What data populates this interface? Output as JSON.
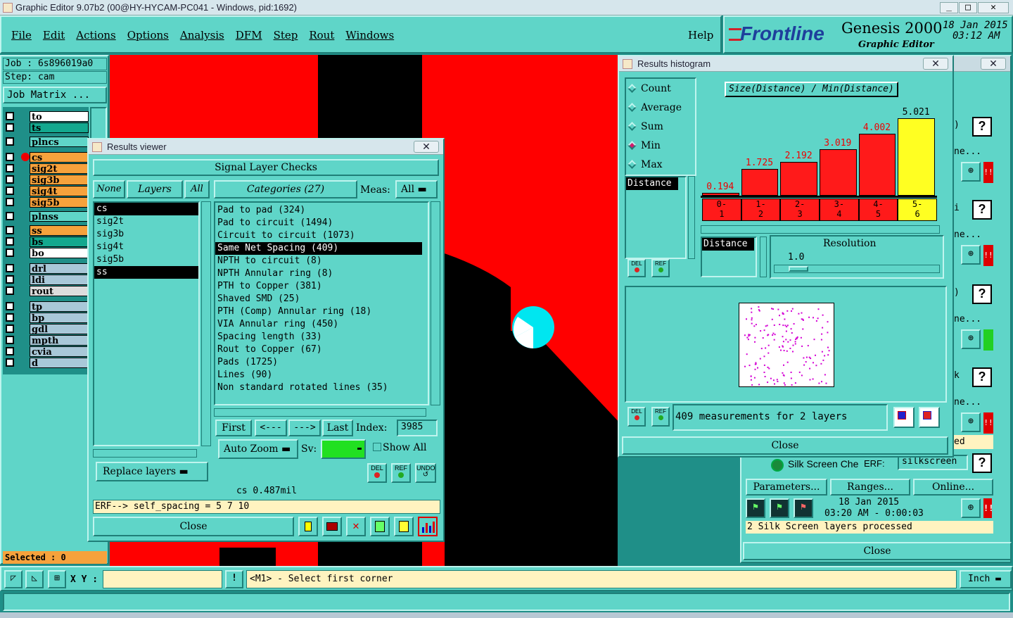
{
  "window": {
    "title": "Graphic Editor 9.07b2 (00@HY-HYCAM-PC041 - Windows, pid:1692)"
  },
  "menu": {
    "items": [
      "File",
      "Edit",
      "Actions",
      "Options",
      "Analysis",
      "DFM",
      "Step",
      "Rout",
      "Windows"
    ],
    "help": "Help"
  },
  "brand": {
    "logo": "Frontline",
    "product": "Genesis 2000",
    "subtitle": "Graphic Editor",
    "date": "18 Jan 2015",
    "time": "03:12 AM"
  },
  "job": {
    "job_label": "Job : 6s896019a0",
    "step_label": "Step: cam",
    "matrix_button": "Job Matrix ..."
  },
  "layers": [
    {
      "name": "to",
      "bg": "#ffffff"
    },
    {
      "name": "ts",
      "bg": "#13a88e"
    },
    {
      "name": "plncs",
      "bg": "#5fd5c8"
    },
    {
      "name": "cs",
      "bg": "#f6a23c"
    },
    {
      "name": "sig2t",
      "bg": "#f6a23c"
    },
    {
      "name": "sig3b",
      "bg": "#f6a23c"
    },
    {
      "name": "sig4t",
      "bg": "#f6a23c"
    },
    {
      "name": "sig5b",
      "bg": "#f6a23c"
    },
    {
      "name": "plnss",
      "bg": "#5fd5c8"
    },
    {
      "name": "ss",
      "bg": "#f6a23c"
    },
    {
      "name": "bs",
      "bg": "#13a88e"
    },
    {
      "name": "bo",
      "bg": "#ffffff"
    },
    {
      "name": "drl",
      "bg": "#a8c8d8"
    },
    {
      "name": "ldi",
      "bg": "#a8c8d8"
    },
    {
      "name": "rout",
      "bg": "#dddddd"
    },
    {
      "name": "tp",
      "bg": "#a8c8d8"
    },
    {
      "name": "bp",
      "bg": "#a8c8d8"
    },
    {
      "name": "gdl",
      "bg": "#a8c8d8"
    },
    {
      "name": "mpth",
      "bg": "#a8c8d8"
    },
    {
      "name": "cvia",
      "bg": "#a8c8d8"
    },
    {
      "name": "d",
      "bg": "#a8c8d8"
    }
  ],
  "selected": "Selected : 0",
  "statusbar": {
    "xy_label": "X Y :",
    "xy_value": "",
    "message": "<M1> - Select first corner",
    "units": "Inch"
  },
  "results_viewer": {
    "title": "Results viewer",
    "heading": "Signal Layer Checks",
    "none_btn": "None",
    "layers_btn": "Layers",
    "all_btn": "All",
    "layer_list": [
      {
        "name": "cs",
        "selected": true
      },
      {
        "name": "sig2t",
        "selected": false
      },
      {
        "name": "sig3b",
        "selected": false
      },
      {
        "name": "sig4t",
        "selected": false
      },
      {
        "name": "sig5b",
        "selected": false
      },
      {
        "name": "ss",
        "selected": true
      }
    ],
    "categories_btn": "Categories (27)",
    "meas_label": "Meas:",
    "meas_value": "All",
    "categories": [
      {
        "label": "Pad to pad (324)",
        "selected": false
      },
      {
        "label": "Pad to circuit (1494)",
        "selected": false
      },
      {
        "label": "Circuit to circuit (1073)",
        "selected": false
      },
      {
        "label": "Same Net Spacing (409)",
        "selected": true
      },
      {
        "label": "NPTH to circuit (8)",
        "selected": false
      },
      {
        "label": "NPTH Annular ring (8)",
        "selected": false
      },
      {
        "label": "PTH to Copper (381)",
        "selected": false
      },
      {
        "label": "Shaved SMD (25)",
        "selected": false
      },
      {
        "label": "PTH (Comp) Annular ring (18)",
        "selected": false
      },
      {
        "label": "VIA Annular ring (450)",
        "selected": false
      },
      {
        "label": "Spacing length (33)",
        "selected": false
      },
      {
        "label": "Rout to Copper (67)",
        "selected": false
      },
      {
        "label": "Pads (1725)",
        "selected": false
      },
      {
        "label": "Lines (90)",
        "selected": false
      },
      {
        "label": "Non standard rotated lines (35)",
        "selected": false
      }
    ],
    "first": "First",
    "prev": "<---",
    "next": "--->",
    "last": "Last",
    "index_label": "Index:",
    "index_value": "3985",
    "auto_zoom": "Auto Zoom",
    "sv_label": "Sv:",
    "show_all": "Show All",
    "del": "DEL",
    "ref": "REF",
    "undo": "UNDO",
    "replace_layers": "Replace layers",
    "status": "cs 0.487mil",
    "erf": "ERF--> self_spacing = 5 7 10",
    "close": "Close",
    "color": "#21e021"
  },
  "histogram": {
    "title": "Results histogram",
    "options": [
      "Count",
      "Average",
      "Sum",
      "Min",
      "Max"
    ],
    "selected_option": "Min",
    "header": "Size(Distance) / Min(Distance)",
    "field": "Distance",
    "bars": [
      {
        "value": "0.194",
        "height": 0.04,
        "range": "0-1"
      },
      {
        "value": "1.725",
        "height": 0.35,
        "range": "1-2"
      },
      {
        "value": "2.192",
        "height": 0.44,
        "range": "2-3"
      },
      {
        "value": "3.019",
        "height": 0.6,
        "range": "3-4"
      },
      {
        "value": "4.002",
        "height": 0.8,
        "range": "4-5"
      },
      {
        "value": "5.021",
        "height": 1.0,
        "range": "5-6"
      }
    ],
    "range_labels": [
      [
        "0-",
        "1"
      ],
      [
        "1-",
        "2"
      ],
      [
        "2-",
        "3"
      ],
      [
        "3-",
        "4"
      ],
      [
        "4-",
        "5"
      ],
      [
        "5-",
        "6"
      ]
    ],
    "resolution_field": "Distance",
    "resolution_label": "Resolution",
    "resolution_value": "1.0",
    "del": "DEL",
    "ref": "REF",
    "measurements": "409 measurements for 2 layers",
    "close": "Close"
  },
  "checklist": {
    "rows": [
      ")",
      "ne...",
      "i",
      "ne...",
      ")",
      "ne...",
      "k",
      "ne...",
      "ed"
    ],
    "silk_label": "Silk Screen Che",
    "erf_label": "ERF:",
    "erf_value": "silkscreen",
    "parameters": "Parameters...",
    "ranges": "Ranges...",
    "online": "Online...",
    "date": "18 Jan 2015",
    "time": "03:20 AM - 0:00:03",
    "status": "2 Silk Screen layers processed",
    "close": "Close"
  }
}
